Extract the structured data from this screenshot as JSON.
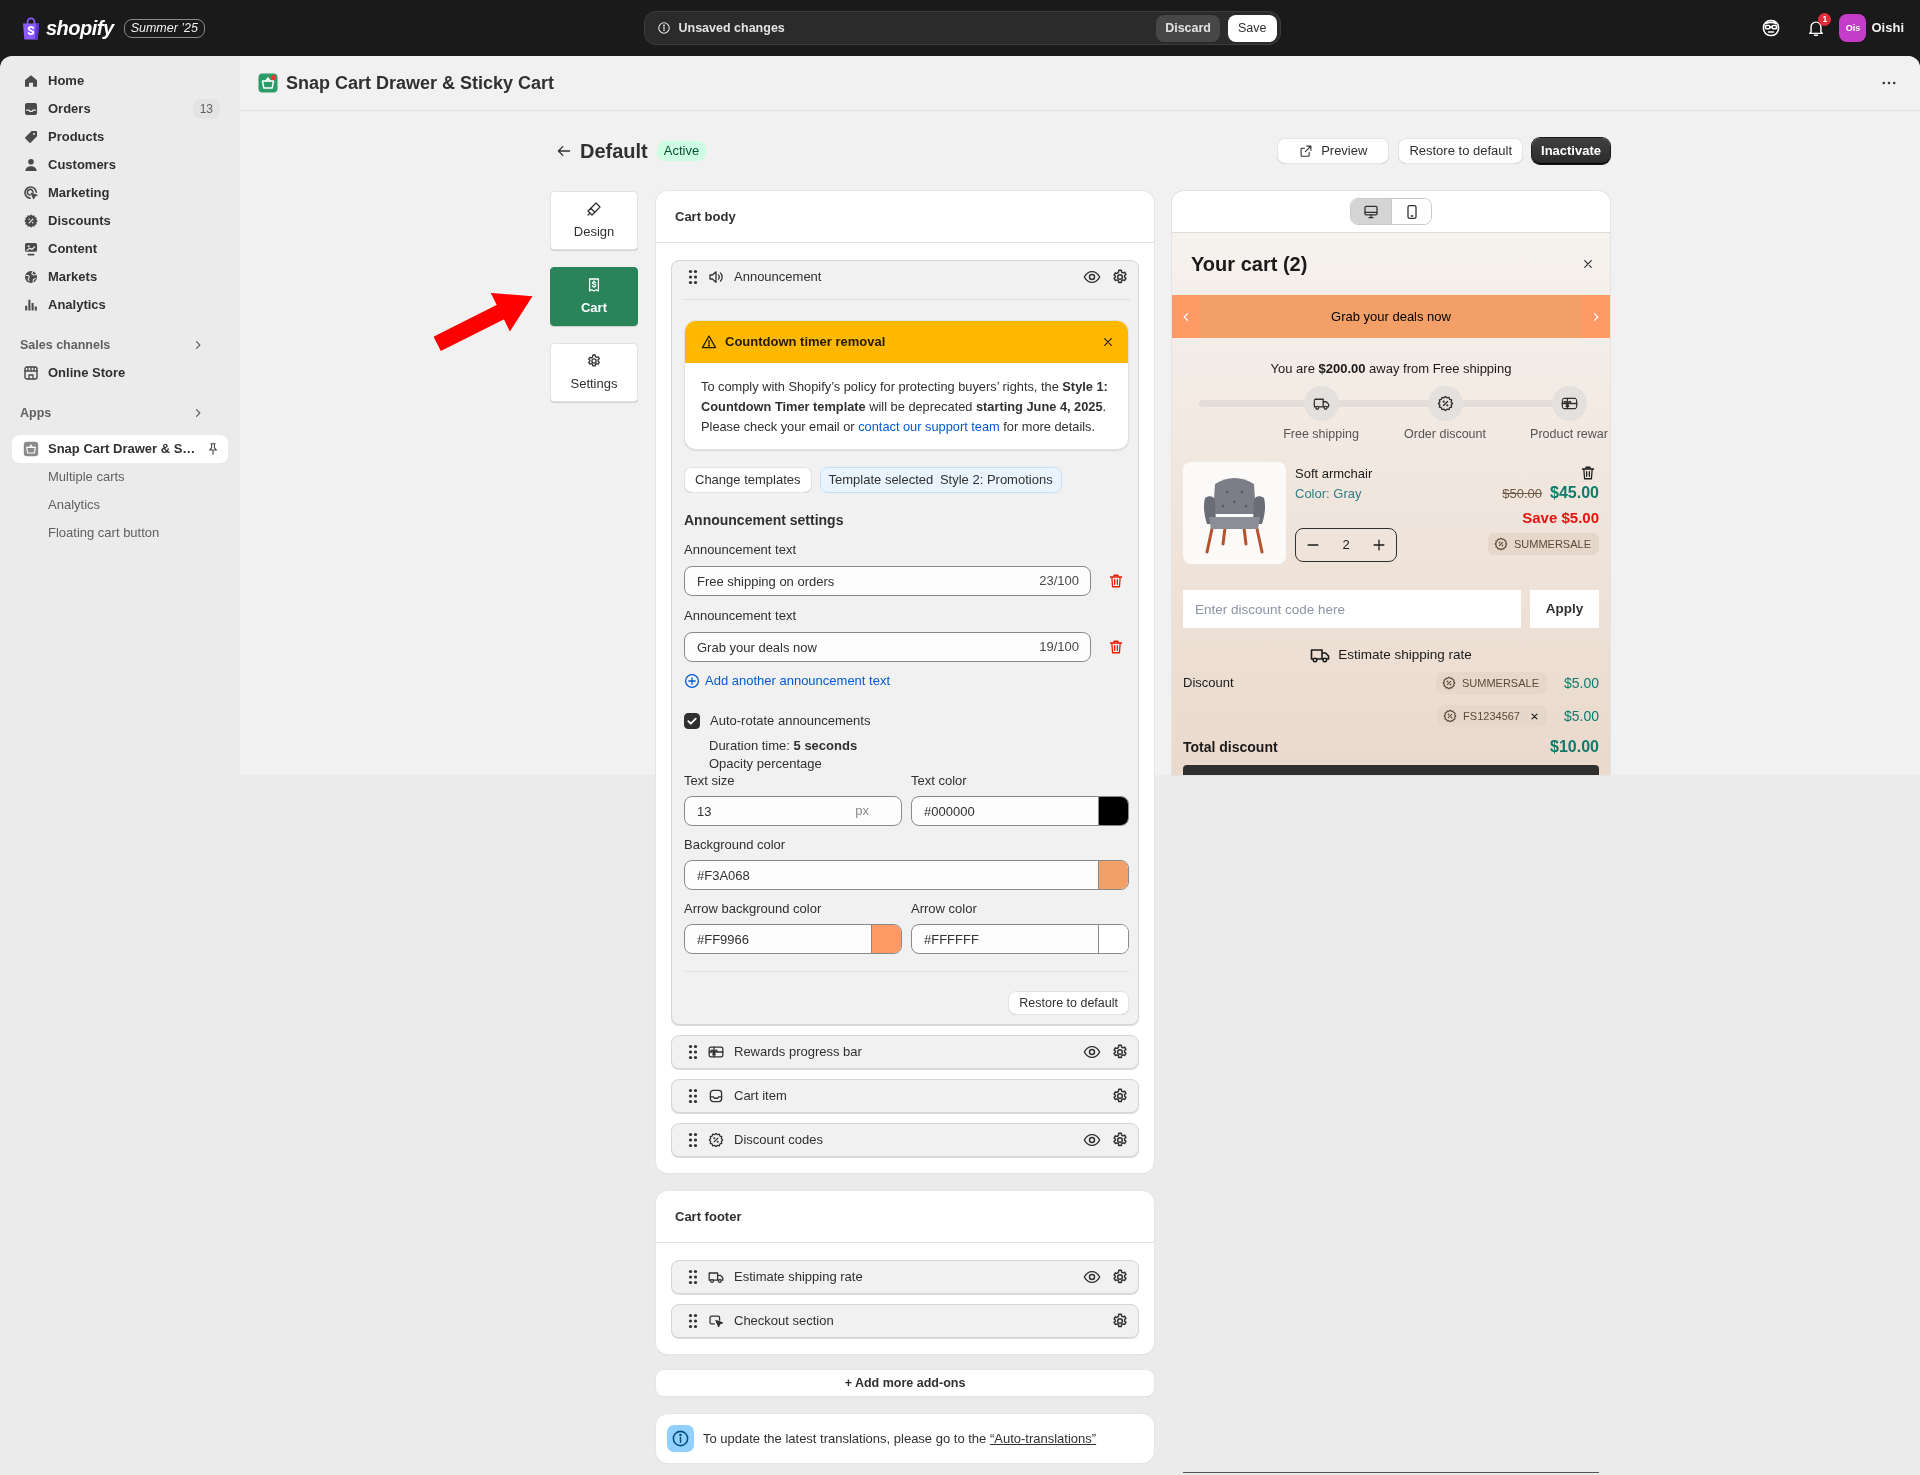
{
  "top_bar": {
    "logo": "shopify",
    "edition": "Summer ’25",
    "unsaved_bar": {
      "message": "Unsaved changes",
      "discard": "Discard",
      "save": "Save"
    },
    "notification_count": "1",
    "user": {
      "initials": "Ois",
      "name": "Oishi"
    }
  },
  "sidebar": {
    "items": [
      {
        "label": "Home",
        "selected": false
      },
      {
        "label": "Orders",
        "count": "13",
        "selected": false
      },
      {
        "label": "Products",
        "selected": false
      },
      {
        "label": "Customers",
        "selected": false
      },
      {
        "label": "Marketing",
        "selected": false
      },
      {
        "label": "Discounts",
        "selected": false
      },
      {
        "label": "Content",
        "selected": false
      },
      {
        "label": "Markets",
        "selected": false
      },
      {
        "label": "Analytics",
        "selected": false
      }
    ],
    "sections": [
      {
        "title": "Sales channels",
        "items": [
          {
            "label": "Online Store",
            "selected": false
          }
        ]
      },
      {
        "title": "Apps",
        "items": [
          {
            "label": "Snap Cart Drawer & S…",
            "selected": true,
            "children": [
              {
                "label": "Multiple carts",
                "selected": false
              },
              {
                "label": "Analytics",
                "selected": false
              },
              {
                "label": "Floating cart button",
                "selected": false
              }
            ]
          }
        ]
      }
    ]
  },
  "app_header": {
    "title": "Snap Cart Drawer & Sticky Cart"
  },
  "page": {
    "title": "Default",
    "status": "Active",
    "actions": [
      {
        "label": "Preview",
        "kind": "external"
      },
      {
        "label": "Restore to default",
        "kind": "secondary"
      },
      {
        "label": "Inactivate",
        "kind": "primary"
      }
    ]
  },
  "annotation": {
    "kind": "arrow"
  },
  "nav_tabs": [
    {
      "label": "Design",
      "selected": false
    },
    {
      "label": "Cart",
      "selected": true
    },
    {
      "label": "Settings",
      "selected": false
    }
  ],
  "cart_body": {
    "title": "Cart body",
    "blocks": [
      {
        "kind": "announcement",
        "label": "Announcement",
        "hideable": true,
        "expanded": true,
        "settings": {
          "notice": {
            "title": "Countdown timer removal",
            "text": "To comply with Shopify’s policy for protecting buyers’ rights, the **Style 1: Countdown Timer template** will be deprecated **starting June 4, 2025**. Please check your email or",
            "link": "contact our support team",
            "text_after": "for more details."
          },
          "change_templates": "Change templates",
          "template": {
            "label": "Template selected",
            "value": "Style 2: Promotions"
          },
          "heading": "Announcement settings",
          "texts": [
            {
              "label": "Announcement text",
              "value": "Free shipping on orders",
              "counter": "23/100"
            },
            {
              "label": "Announcement text",
              "value": "Grab your deals now",
              "counter": "19/100"
            }
          ],
          "add_text": "Add another announcement text",
          "auto_rotate": {
            "label": "Auto-rotate announcements",
            "checked": true
          },
          "duration": "Duration time: **5 seconds**",
          "opacity_label": "Opacity percentage",
          "field_rows": [
            [
              {
                "kind": "number",
                "label": "Text size",
                "value": "13",
                "unit": "px"
              },
              {
                "kind": "color",
                "label": "Text color",
                "value": "#000000",
                "color": "#000000"
              }
            ],
            [
              {
                "kind": "color",
                "label": "Background color",
                "value": "#F3A068",
                "color": "#f3a068"
              }
            ],
            [
              {
                "kind": "color",
                "label": "Arrow background color",
                "value": "#FF9966",
                "color": "#ff9966"
              },
              {
                "kind": "color",
                "label": "Arrow color",
                "value": "#FFFFFF",
                "color": "#ffffff"
              }
            ]
          ],
          "restore": "Restore to default"
        }
      },
      {
        "kind": "rewards",
        "label": "Rewards progress bar",
        "hideable": true,
        "expanded": false
      },
      {
        "kind": "item",
        "label": "Cart item",
        "hideable": false,
        "expanded": false
      },
      {
        "kind": "discounts",
        "label": "Discount codes",
        "hideable": true,
        "expanded": false
      }
    ]
  },
  "cart_footer": {
    "title": "Cart footer",
    "blocks": [
      {
        "kind": "shipping",
        "label": "Estimate shipping rate",
        "hideable": true,
        "expanded": false
      },
      {
        "kind": "checkout",
        "label": "Checkout section",
        "hideable": false,
        "expanded": false
      }
    ]
  },
  "add_more": "+ Add more add-ons",
  "info_banner": {
    "text": "To update the latest translations, please go to the",
    "link": "“Auto-translations”"
  },
  "preview": {
    "devices": [
      {
        "kind": "desktop",
        "selected": true
      },
      {
        "kind": "mobile",
        "selected": false
      }
    ],
    "title": "Your cart (2)",
    "announcement": "Grab your deals now",
    "goal": "You are **$200.00** away from Free shipping",
    "rewards": {
      "level": 0,
      "milestones": [
        {
          "label": "Free shipping"
        },
        {
          "label": "Order discount"
        },
        {
          "label": "Product rewar"
        }
      ]
    },
    "product": {
      "name": "Soft armchair",
      "variant": "Color: Gray",
      "quantity": "2",
      "compare_price": "$50.00",
      "price": "$45.00",
      "savings": "Save $5.00",
      "code": "SUMMERSALE"
    },
    "discount_form": {
      "placeholder": "Enter discount code here",
      "button": "Apply"
    },
    "shipping_estimate": "Estimate shipping rate",
    "discounts": {
      "label": "Discount",
      "codes": [
        {
          "code": "SUMMERSALE",
          "amount": "$5.00",
          "removable": false
        },
        {
          "code": "FS1234567",
          "amount": "$5.00",
          "removable": true
        }
      ]
    },
    "total": {
      "label": "Total discount",
      "amount": "$10.00"
    }
  }
}
